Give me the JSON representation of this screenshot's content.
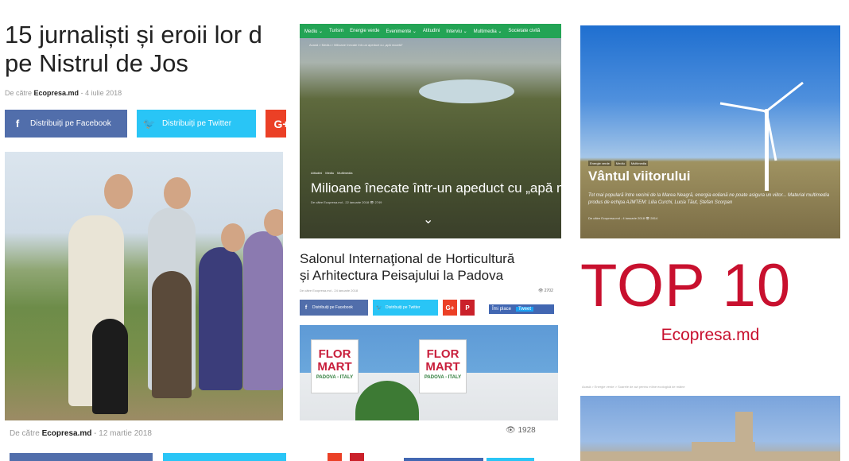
{
  "left_article": {
    "title_line1": "15 jurnaliști și eroii lor d",
    "title_line2": "pe Nistrul de Jos",
    "byline_prefix": "De către",
    "author": "Ecopresa.md",
    "date": "- 4 iulie 2018",
    "share_facebook": "Distribuiți pe Facebook",
    "share_twitter": "Distribuiți pe Twitter",
    "share_gplus": "G+",
    "bottom_byline_prefix": "De către",
    "bottom_author": "Ecopresa.md",
    "bottom_date": "- 12 martie 2018",
    "icon_facebook": "f",
    "icon_twitter": "🐦"
  },
  "video_card": {
    "nav": [
      "Mediu ⌄",
      "Turism",
      "Energie verde",
      "Evenimente ⌄",
      "Atitudini",
      "Interviu ⌄",
      "Multimedia ⌄",
      "Societate civilă"
    ],
    "breadcrumb": "Acasă > Mediu > Milioane înecate într-un apeduct cu „apă moartă”",
    "tags": [
      "Atitudini",
      "Mediu",
      "Multimedia"
    ],
    "title": "Milioane înecate într-un apeduct cu „apă moa",
    "meta": "De către Ecopresa.md - 22 ianuarie 2018",
    "views": "2749",
    "chevron": "⌄"
  },
  "middle_article": {
    "title_line1": "Salonul Internaţional de Horticultură",
    "title_line2": "și Arhitectura Peisajului la Padova",
    "meta": "De către Ecopresa.md - 24 ianuarie 2018",
    "views": "2702",
    "share_facebook": "Distribuiți pe Facebook",
    "share_twitter": "Distribuiți pe Twitter",
    "share_gplus": "G+",
    "share_pinterest": "P",
    "like": "Îmi place",
    "tweet": "Tweet",
    "sign_flor": "FLOR",
    "sign_mart": "MART",
    "sign_padova": "PADOVA - ITALY"
  },
  "wind_card": {
    "tags": [
      "Energie verde",
      "Mediu",
      "Multimedia"
    ],
    "title": "Vântul viitorului",
    "description": "Tot mai populară între vecinii de la Marea Neagră, energia eoliană ne poate asigura un viitor... Material multimedia produs de echipa AJMTEM: Lilia Curchi, Lucia Tăut, Ștefan Scorpan",
    "meta": "De către Ecopresa.md - 4 ianuarie 2018",
    "views": "2814"
  },
  "promo": {
    "headline": "TOP 10",
    "brand": "Ecopresa.md"
  },
  "bottom_right_card": {
    "breadcrumb": "Acasă > Energie verde > Soarele de azi pentru mîine ecologică de mâine"
  },
  "bottom_views": "1928",
  "colors": {
    "accent_red": "#c8102e",
    "facebook": "#516eab",
    "twitter": "#29c5f6",
    "gplus": "#eb4026",
    "nav_green": "#23a455"
  }
}
